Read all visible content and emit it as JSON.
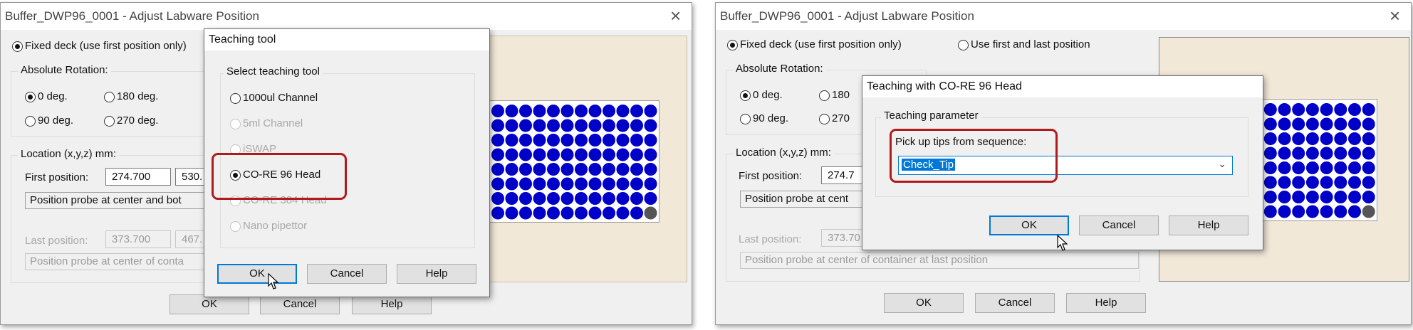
{
  "colors": {
    "accent": "#0078d7",
    "highlight": "#b11a1a",
    "well": "#0000c8",
    "well_empty": "#555555",
    "deck": "#f2e8d8"
  },
  "left": {
    "title": "Buffer_DWP96_0001 - Adjust Labware Position",
    "close_icon": "close-icon",
    "fixed_deck_label": "Fixed deck (use first position only)",
    "rotation_label": "Absolute Rotation:",
    "rot_0": "0 deg.",
    "rot_180": "180 deg.",
    "rot_90": "90 deg.",
    "rot_270": "270 deg.",
    "location_label": "Location (x,y,z) mm:",
    "first_label": "First position:",
    "first_x": "274.700",
    "first_y": "530.",
    "first_probe": "Position probe at center and bot",
    "last_label": "Last position:",
    "last_x": "373.700",
    "last_y": "467.",
    "last_probe": "Position probe at center of conta",
    "ok": "OK",
    "cancel": "Cancel",
    "help": "Help",
    "teaching_tool": {
      "title": "Teaching tool",
      "group_label": "Select teaching tool",
      "options": [
        "1000ul Channel",
        "5ml Channel",
        "iSWAP",
        "CO-RE 96 Head",
        "CO-RE 384 Head",
        "Nano pipettor"
      ],
      "ok": "OK",
      "cancel": "Cancel",
      "help": "Help"
    }
  },
  "right": {
    "title": "Buffer_DWP96_0001 - Adjust Labware Position",
    "fixed_deck_label": "Fixed deck (use first position only)",
    "first_last_label": "Use first and last position",
    "rotation_label": "Absolute Rotation:",
    "rot_0": "0 deg.",
    "rot_180": "180",
    "rot_90": "90 deg.",
    "rot_270": "270",
    "location_label": "Location (x,y,z) mm:",
    "first_label": "First position:",
    "first_x": "274.7",
    "first_probe": "Position probe at cent",
    "last_label": "Last position:",
    "last_x": "373.70",
    "last_probe": "Position probe at center of container at last position",
    "ok": "OK",
    "cancel": "Cancel",
    "help": "Help",
    "teaching": {
      "title": "Teaching with CO-RE 96 Head",
      "group_label": "Teaching parameter",
      "pickup_label": "Pick up tips from sequence:",
      "pickup_value": "Check_Tip",
      "ok": "OK",
      "cancel": "Cancel",
      "help": "Help"
    }
  }
}
